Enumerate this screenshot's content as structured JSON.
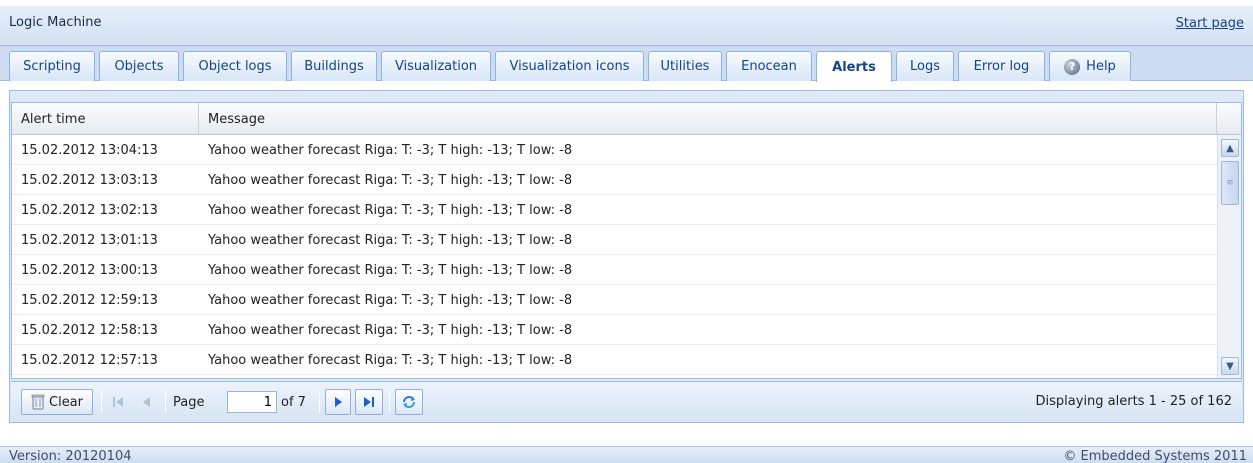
{
  "header": {
    "title": "Logic Machine",
    "start_page": "Start page"
  },
  "tabs": [
    {
      "label": "Scripting"
    },
    {
      "label": "Objects"
    },
    {
      "label": "Object logs"
    },
    {
      "label": "Buildings"
    },
    {
      "label": "Visualization"
    },
    {
      "label": "Visualization icons"
    },
    {
      "label": "Utilities"
    },
    {
      "label": "Enocean"
    },
    {
      "label": "Alerts",
      "active": true
    },
    {
      "label": "Logs"
    },
    {
      "label": "Error log"
    },
    {
      "label": "Help",
      "icon": "help-icon"
    }
  ],
  "grid": {
    "columns": [
      "Alert time",
      "Message"
    ],
    "rows": [
      {
        "time": "15.02.2012 13:04:13",
        "message": "Yahoo weather forecast Riga: T: -3; T high: -13; T low: -8"
      },
      {
        "time": "15.02.2012 13:03:13",
        "message": "Yahoo weather forecast Riga: T: -3; T high: -13; T low: -8"
      },
      {
        "time": "15.02.2012 13:02:13",
        "message": "Yahoo weather forecast Riga: T: -3; T high: -13; T low: -8"
      },
      {
        "time": "15.02.2012 13:01:13",
        "message": "Yahoo weather forecast Riga: T: -3; T high: -13; T low: -8"
      },
      {
        "time": "15.02.2012 13:00:13",
        "message": "Yahoo weather forecast Riga: T: -3; T high: -13; T low: -8"
      },
      {
        "time": "15.02.2012 12:59:13",
        "message": "Yahoo weather forecast Riga: T: -3; T high: -13; T low: -8"
      },
      {
        "time": "15.02.2012 12:58:13",
        "message": "Yahoo weather forecast Riga: T: -3; T high: -13; T low: -8"
      },
      {
        "time": "15.02.2012 12:57:13",
        "message": "Yahoo weather forecast Riga: T: -3; T high: -13; T low: -8"
      }
    ]
  },
  "pager": {
    "clear_label": "Clear",
    "page_label": "Page",
    "page_value": "1",
    "of_label": "of 7",
    "display_info": "Displaying alerts 1 - 25 of 162"
  },
  "footer": {
    "version": "Version: 20120104",
    "copyright": "© Embedded Systems 2011"
  },
  "colors": {
    "accent": "#15428b",
    "border": "#99bbe8",
    "tab_bg": "#cddcf0"
  }
}
